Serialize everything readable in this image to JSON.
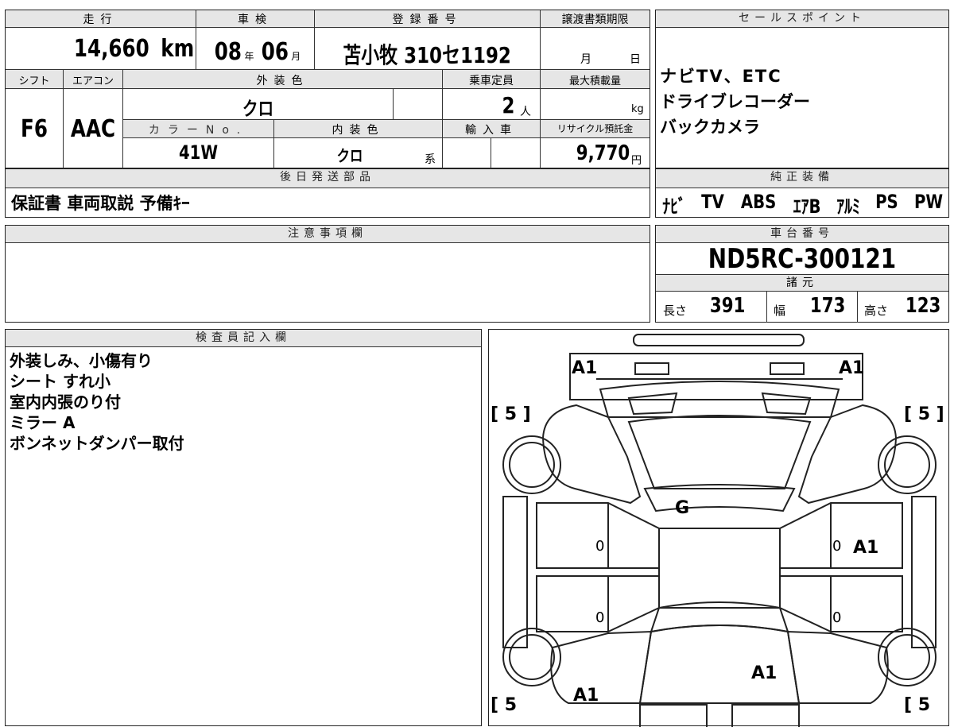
{
  "top": {
    "mileage_label": "走行",
    "mileage_value": "14,660",
    "mileage_unit": "km",
    "inspection_label": "車検",
    "inspection_year": "08",
    "inspection_year_unit": "年",
    "inspection_month": "06",
    "inspection_month_unit": "月",
    "registration_label": "登録番号",
    "registration_value": "苫小牧 310セ1192",
    "transfer_label": "譲渡書類期限",
    "transfer_month_unit": "月",
    "transfer_day_unit": "日"
  },
  "row2": {
    "shift_label": "シフト",
    "shift_value": "F6",
    "ac_label": "エアコン",
    "ac_value": "AAC",
    "exterior_label": "外装色",
    "exterior_value": "クロ",
    "capacity_label": "乗車定員",
    "capacity_value": "2",
    "capacity_unit": "人",
    "maxload_label": "最大積載量",
    "maxload_unit": "kg",
    "color_no_label": "カラーNo.",
    "color_no_value": "41W",
    "interior_label": "内装色",
    "interior_value": "クロ",
    "interior_suffix": "系",
    "import_label": "輸入車",
    "recycle_label": "リサイクル預託金",
    "recycle_value": "9,770",
    "recycle_unit": "円"
  },
  "later_parts": {
    "label": "後日発送部品",
    "value": "保証書 車両取説 予備ｷｰ"
  },
  "sales_points": {
    "label": "セールスポイント",
    "lines": [
      "ナビTV、ETC",
      "ドライブレコーダー",
      "バックカメラ"
    ]
  },
  "genuine_equipment": {
    "label": "純正装備",
    "items": [
      "ﾅﾋﾞ",
      "TV",
      "ABS",
      "ｴｱB",
      "ｱﾙﾐ",
      "PS",
      "PW"
    ]
  },
  "notes": {
    "label": "注意事項欄"
  },
  "chassis": {
    "label": "車台番号",
    "value": "ND5RC-300121"
  },
  "specs": {
    "label": "諸元",
    "length_label": "長さ",
    "length_value": "391",
    "width_label": "幅",
    "width_value": "173",
    "height_label": "高さ",
    "height_value": "123"
  },
  "inspector": {
    "label": "検査員記入欄",
    "lines": [
      "外装しみ、小傷有り",
      "シート すれ小",
      "室内内張のり付",
      "ミラー A",
      "ボンネットダンパー取付"
    ]
  },
  "diagram": {
    "marks": {
      "front_left": "A1",
      "front_right": "A1",
      "windshield": "G",
      "right_front_door": "A1",
      "trunk": "A1",
      "rear_left": "A1",
      "door_left_front": "0",
      "door_left_rear": "0",
      "door_right_front": "0",
      "door_right_rear": "0"
    },
    "tire_fl": "[ 5 ]",
    "tire_fr": "[ 5 ]",
    "tire_rl": "[ 5",
    "tire_rr": "[ 5"
  }
}
